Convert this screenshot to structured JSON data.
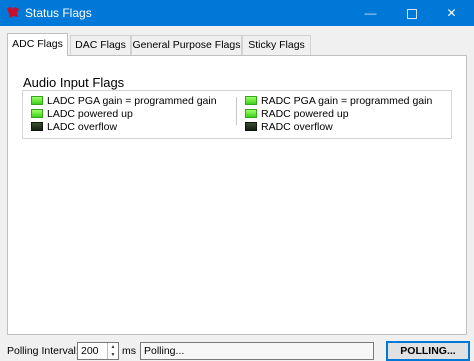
{
  "window": {
    "title": "Status Flags",
    "controls": {
      "minimize": "—",
      "close": "✕"
    }
  },
  "tabs": [
    {
      "label": "ADC Flags",
      "active": true
    },
    {
      "label": "DAC Flags",
      "active": false
    },
    {
      "label": "General Purpose Flags",
      "active": false
    },
    {
      "label": "Sticky Flags",
      "active": false
    }
  ],
  "group": {
    "title": "Audio Input Flags",
    "left_flags": [
      {
        "label": "LADC PGA gain = programmed gain",
        "state": "on"
      },
      {
        "label": "LADC powered up",
        "state": "on"
      },
      {
        "label": "LADC overflow",
        "state": "off"
      }
    ],
    "right_flags": [
      {
        "label": "RADC PGA gain = programmed gain",
        "state": "on"
      },
      {
        "label": "RADC powered up",
        "state": "on"
      },
      {
        "label": "RADC overflow",
        "state": "off"
      }
    ]
  },
  "colors": {
    "titlebar": "#0078d7",
    "led_on": "#3ed11b",
    "led_off": "#142010"
  },
  "statusbar": {
    "polling_label": "Polling Interval:",
    "polling_value": "200",
    "unit": "ms",
    "status_text": "Polling...",
    "poll_button": "POLLING..."
  }
}
